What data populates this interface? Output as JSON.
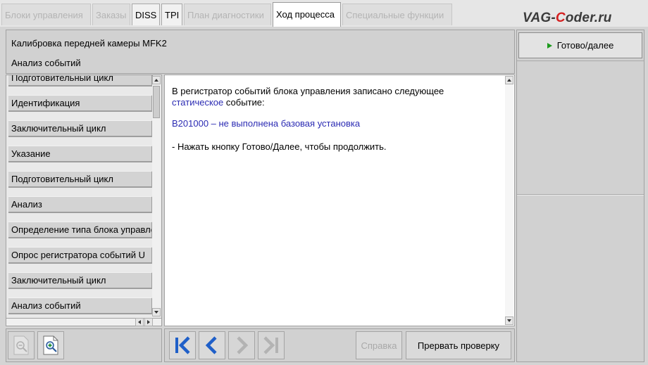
{
  "tabs": [
    {
      "label": "Блоки управления",
      "state": "disabled"
    },
    {
      "label": "Заказы",
      "state": "disabled"
    },
    {
      "label": "DISS",
      "state": "enabled"
    },
    {
      "label": "TPI",
      "state": "enabled"
    },
    {
      "label": "План диагностики",
      "state": "disabled"
    },
    {
      "label": "Ход процесса",
      "state": "active"
    },
    {
      "label": "Специальные функции",
      "state": "disabled"
    }
  ],
  "watermark": {
    "part1": "VAG-",
    "part2": "C",
    "part3": "oder.ru"
  },
  "header": {
    "title": "Калибровка передней камеры MFK2",
    "subtitle": "Анализ событий"
  },
  "steps": [
    "Подготовительный цикл",
    "Идентификация",
    "Заключительный цикл",
    "Указание",
    "Подготовительный цикл",
    "Анализ",
    "Определение типа блока управления",
    "Опрос регистратора событий U",
    "Заключительный цикл",
    "Анализ событий"
  ],
  "content": {
    "line1": "В регистратор событий блока управления записано следующее",
    "line2_blue": "статическое",
    "line2_rest": " событие:",
    "event": "B201000 – не выполнена базовая установка",
    "instruction": "- Нажать кнопку Готово/Далее, чтобы продолжить."
  },
  "buttons": {
    "ready": "Готово/далее",
    "help": "Справка",
    "abort": "Прервать проверку"
  },
  "icons": {
    "zoom_out": "zoom-out-icon",
    "zoom_in": "zoom-in-icon",
    "first": "skip-first-icon",
    "back": "chevron-left-icon",
    "forward": "chevron-right-icon",
    "last": "skip-last-icon"
  },
  "colors": {
    "accent_blue": "#2b2bb3",
    "nav_blue": "#1f5fc8",
    "play_green": "#1c9a1c"
  }
}
